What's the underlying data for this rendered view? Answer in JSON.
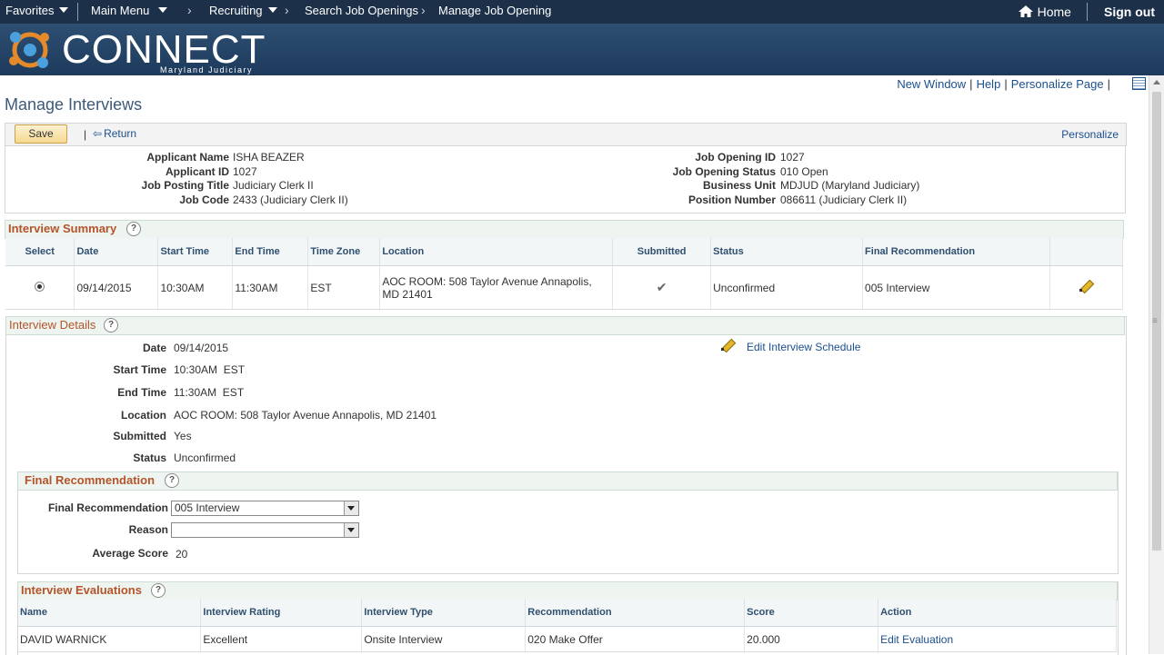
{
  "nav": {
    "favorites": "Favorites",
    "main_menu": "Main Menu",
    "breadcrumb": [
      "Recruiting",
      "Search Job Openings",
      "Manage Job Opening"
    ],
    "home": "Home",
    "sign_out": "Sign out"
  },
  "banner": {
    "logo": "CONNECT",
    "sub": "Maryland Judiciary"
  },
  "top_links": [
    "New Window",
    "Help",
    "Personalize Page"
  ],
  "page_title": "Manage Interviews",
  "toolbar": {
    "save": "Save",
    "return": "Return",
    "personalize": "Personalize"
  },
  "header": {
    "left": [
      {
        "label": "Applicant Name",
        "value": "ISHA BEAZER"
      },
      {
        "label": "Applicant ID",
        "value": "1027"
      },
      {
        "label": "Job Posting Title",
        "value": "Judiciary Clerk II"
      },
      {
        "label": "Job Code",
        "value": "2433 (Judiciary Clerk II)"
      }
    ],
    "right": [
      {
        "label": "Job Opening ID",
        "value": "1027"
      },
      {
        "label": "Job Opening Status",
        "value": "010 Open"
      },
      {
        "label": "Business Unit",
        "value": "MDJUD (Maryland Judiciary)"
      },
      {
        "label": "Position Number",
        "value": "086611 (Judiciary Clerk II)"
      }
    ]
  },
  "summary": {
    "title": "Interview Summary",
    "columns": [
      "Select",
      "Date",
      "Start Time",
      "End Time",
      "Time Zone",
      "Location",
      "Submitted",
      "Status",
      "Final Recommendation"
    ],
    "row": {
      "date": "09/14/2015",
      "start": "10:30AM",
      "end": "11:30AM",
      "tz": "EST",
      "location": "AOC ROOM: 508 Taylor Avenue Annapolis, MD 21401",
      "status": "Unconfirmed",
      "final_rec": "005 Interview"
    }
  },
  "details": {
    "title": "Interview Details",
    "edit_schedule": "Edit Interview Schedule",
    "fields": [
      {
        "label": "Date",
        "value": "09/14/2015"
      },
      {
        "label": "Start Time",
        "value": "10:30AM  EST"
      },
      {
        "label": "End Time",
        "value": "11:30AM  EST"
      },
      {
        "label": "Location",
        "value": "AOC ROOM: 508 Taylor Avenue Annapolis, MD 21401"
      },
      {
        "label": "Submitted",
        "value": "Yes"
      },
      {
        "label": "Status",
        "value": "Unconfirmed"
      }
    ]
  },
  "final_rec": {
    "title": "Final Recommendation",
    "rec_label": "Final Recommendation",
    "rec_value": "005 Interview",
    "reason_label": "Reason",
    "reason_value": "",
    "avg_label": "Average Score",
    "avg_value": "20"
  },
  "evaluations": {
    "title": "Interview Evaluations",
    "columns": [
      "Name",
      "Interview Rating",
      "Interview Type",
      "Recommendation",
      "Score",
      "Action"
    ],
    "row": {
      "name": "DAVID WARNICK",
      "rating": "Excellent",
      "type": "Onsite Interview",
      "rec": "020 Make Offer",
      "score": "20.000",
      "action": "Edit Evaluation"
    }
  }
}
